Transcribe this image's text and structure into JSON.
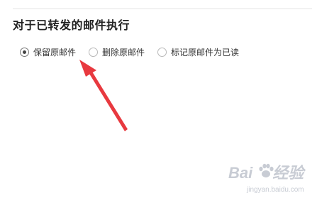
{
  "section": {
    "title": "对于已转发的邮件执行"
  },
  "options": [
    {
      "label": "保留原邮件",
      "selected": true
    },
    {
      "label": "删除原邮件",
      "selected": false
    },
    {
      "label": "标记原邮件为已读",
      "selected": false
    }
  ],
  "watermark": {
    "logo_text": "Bai",
    "logo_text_end": "经验",
    "sub_text": "jingyan.baidu.com"
  },
  "colors": {
    "arrow": "#e8393f",
    "title": "#222222",
    "radio_dot": "#444444"
  }
}
